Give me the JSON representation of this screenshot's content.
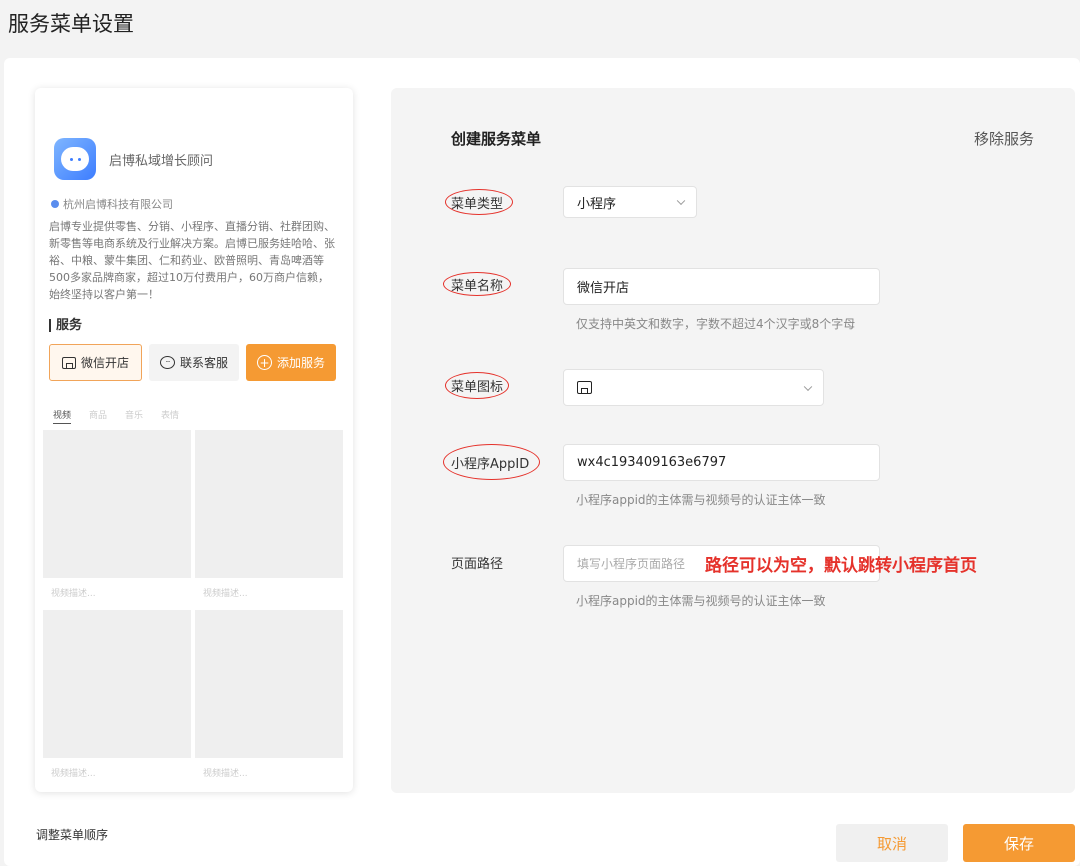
{
  "page": {
    "title": "服务菜单设置"
  },
  "preview": {
    "app_name": "启博私域增长顾问",
    "company": "杭州启博科技有限公司",
    "description": "启博专业提供零售、分销、小程序、直播分销、社群团购、新零售等电商系统及行业解决方案。启博已服务娃哈哈、张裕、中粮、蒙牛集团、仁和药业、欧普照明、青岛啤酒等500多家品牌商家，超过10万付费用户，60万商户信赖，始终坚持以客户第一！",
    "services_title": "服务",
    "service_buttons": [
      {
        "label": "微信开店",
        "icon": "store-icon"
      },
      {
        "label": "联系客服",
        "icon": "chat-icon"
      },
      {
        "label": "添加服务",
        "icon": "plus-circle-icon"
      }
    ],
    "tabs": [
      "视频",
      "商品",
      "音乐",
      "表情"
    ],
    "tile_caption": "视频描述..."
  },
  "form": {
    "title": "创建服务菜单",
    "remove_label": "移除服务",
    "type": {
      "label": "菜单类型",
      "value": "小程序"
    },
    "name": {
      "label": "菜单名称",
      "value": "微信开店",
      "hint": "仅支持中英文和数字，字数不超过4个汉字或8个字母"
    },
    "icon": {
      "label": "菜单图标",
      "value_icon": "store-icon"
    },
    "appid": {
      "label": "小程序AppID",
      "value": "wx4c193409163e6797",
      "hint": "小程序appid的主体需与视频号的认证主体一致"
    },
    "path": {
      "label": "页面路径",
      "placeholder": "填写小程序页面路径",
      "hint": "小程序appid的主体需与视频号的认证主体一致"
    },
    "annotation": "路径可以为空，默认跳转小程序首页"
  },
  "footer": {
    "reorder_label": "调整菜单顺序",
    "cancel_label": "取消",
    "save_label": "保存"
  },
  "colors": {
    "accent": "#f59a33",
    "annotation": "#e5322b"
  }
}
